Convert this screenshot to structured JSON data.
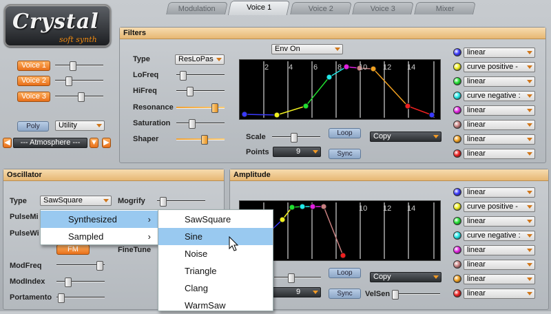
{
  "logo": {
    "title": "Crystal",
    "subtitle": "soft synth"
  },
  "tabs": [
    "Modulation",
    "Voice 1",
    "Voice 2",
    "Voice 3",
    "Mixer"
  ],
  "voices": {
    "buttons": [
      "Voice 1",
      "Voice 2",
      "Voice 3"
    ],
    "levels": [
      0.35,
      0.25,
      0.55
    ]
  },
  "poly": {
    "label": "Poly",
    "utility": "Utility"
  },
  "preset": {
    "name": "--- Atmosphere ---"
  },
  "filters": {
    "title": "Filters",
    "type_label": "Type",
    "type_value": "ResLoPas",
    "rows": [
      {
        "label": "LoFreq",
        "level": 0.08
      },
      {
        "label": "HiFreq",
        "level": 0.25
      },
      {
        "label": "Resonance",
        "level": 0.85
      },
      {
        "label": "Saturation",
        "level": 0.3
      },
      {
        "label": "Shaper",
        "level": 0.6
      }
    ],
    "env_mode": "Env On",
    "x_ticks": [
      "2",
      "4",
      "6",
      "8",
      "10",
      "12",
      "14"
    ],
    "scale_label": "Scale",
    "scale_level": 0.45,
    "points_label": "Points",
    "points_value": "9",
    "loop": "Loop",
    "sync": "Sync",
    "copy": "Copy"
  },
  "mod_rows": [
    {
      "color": "#3a3aff",
      "value": "linear"
    },
    {
      "color": "#f0f020",
      "value": "curve positive -"
    },
    {
      "color": "#20e030",
      "value": "linear"
    },
    {
      "color": "#20e8e8",
      "value": "curve negative :"
    },
    {
      "color": "#e020e0",
      "value": "linear"
    },
    {
      "color": "#c88080",
      "value": "linear"
    },
    {
      "color": "#f0a020",
      "value": "linear"
    },
    {
      "color": "#ee2020",
      "value": "linear"
    }
  ],
  "amp_mod_rows": [
    {
      "color": "#3a3aff",
      "value": "linear"
    },
    {
      "color": "#f0f020",
      "value": "curve positive -"
    },
    {
      "color": "#20e030",
      "value": "linear"
    },
    {
      "color": "#20e8e8",
      "value": "curve negative :"
    },
    {
      "color": "#e020e0",
      "value": "linear"
    },
    {
      "color": "#c88080",
      "value": "linear"
    },
    {
      "color": "#f0a020",
      "value": "linear"
    },
    {
      "color": "#ee2020",
      "value": "linear"
    }
  ],
  "oscillator": {
    "title": "Oscillator",
    "type_label": "Type",
    "type_value": "SawSquare",
    "mogrify": "Mogrify",
    "pulsemix": "PulseMi",
    "pulsewidth": "PulseWi",
    "fm": "FM",
    "finetune": "FineTune",
    "modfreq": "ModFreq",
    "modindex": "ModIndex",
    "portamento": "Portamento"
  },
  "amplitude": {
    "title": "Amplitude",
    "x_ticks": [
      "10",
      "12",
      "14"
    ],
    "points_value": "9",
    "loop": "Loop",
    "sync": "Sync",
    "copy": "Copy",
    "velsen": "VelSen"
  },
  "menu": {
    "items": [
      "Synthesized",
      "Sampled"
    ],
    "submenu": [
      "SawSquare",
      "Sine",
      "Noise",
      "Triangle",
      "Clang",
      "WarmSaw"
    ],
    "selected_sub": "Sine"
  }
}
